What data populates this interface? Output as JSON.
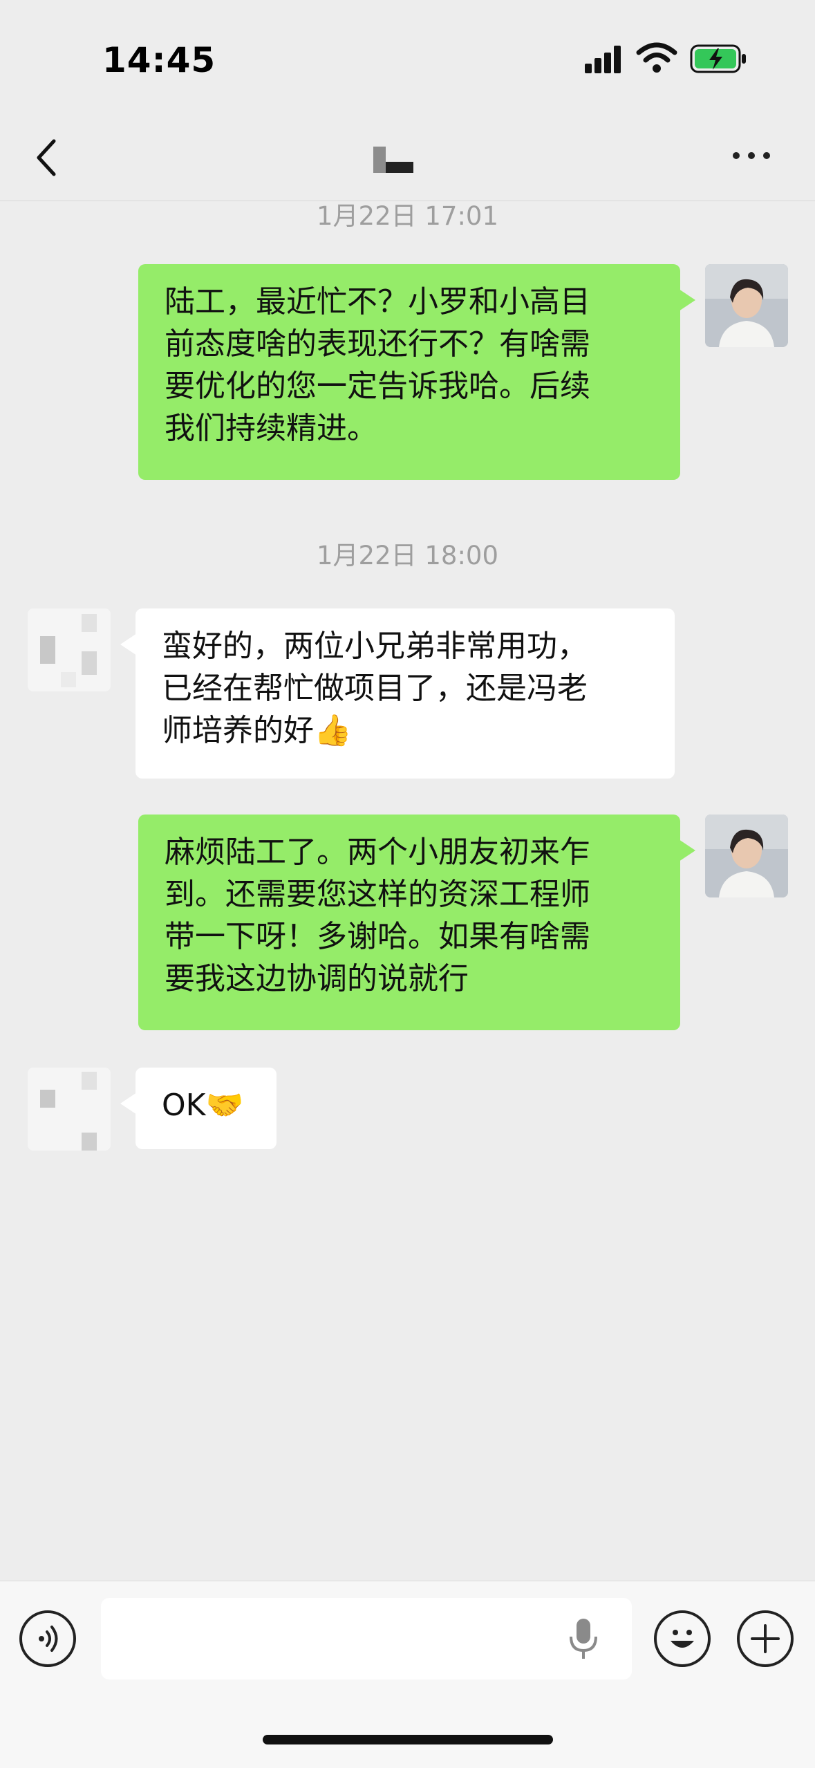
{
  "status_bar": {
    "time": "14:45"
  },
  "header": {
    "title": "",
    "back_icon": "chevron-left-icon",
    "more_icon": "more-dots-icon"
  },
  "messages": [
    {
      "type": "timestamp",
      "text": "1月22日 17:01"
    },
    {
      "type": "message",
      "side": "right",
      "text": "陆工，最近忙不？小罗和小高目\n前态度啥的表现还行不？有啥需\n要优化的您一定告诉我哈。后续\n我们持续精进。"
    },
    {
      "type": "timestamp",
      "text": "1月22日 18:00"
    },
    {
      "type": "message",
      "side": "left",
      "text": "蛮好的，两位小兄弟非常用功，\n已经在帮忙做项目了，还是冯老\n师培养的好",
      "emoji": "👍"
    },
    {
      "type": "message",
      "side": "right",
      "text": "麻烦陆工了。两个小朋友初来乍\n到。还需要您这样的资深工程师\n带一下呀！多谢哈。如果有啥需\n要我这边协调的说就行"
    },
    {
      "type": "message",
      "side": "left",
      "text": "OK",
      "emoji": "🤝"
    }
  ],
  "input_bar": {
    "placeholder": "",
    "value": "",
    "icons": [
      "voice-icon",
      "microphone-icon",
      "emoji-icon",
      "plus-icon"
    ]
  },
  "colors": {
    "background": "#ededed",
    "my_bubble": "#95ec69",
    "other_bubble": "#ffffff",
    "timestamp_text": "#9e9e9e"
  }
}
